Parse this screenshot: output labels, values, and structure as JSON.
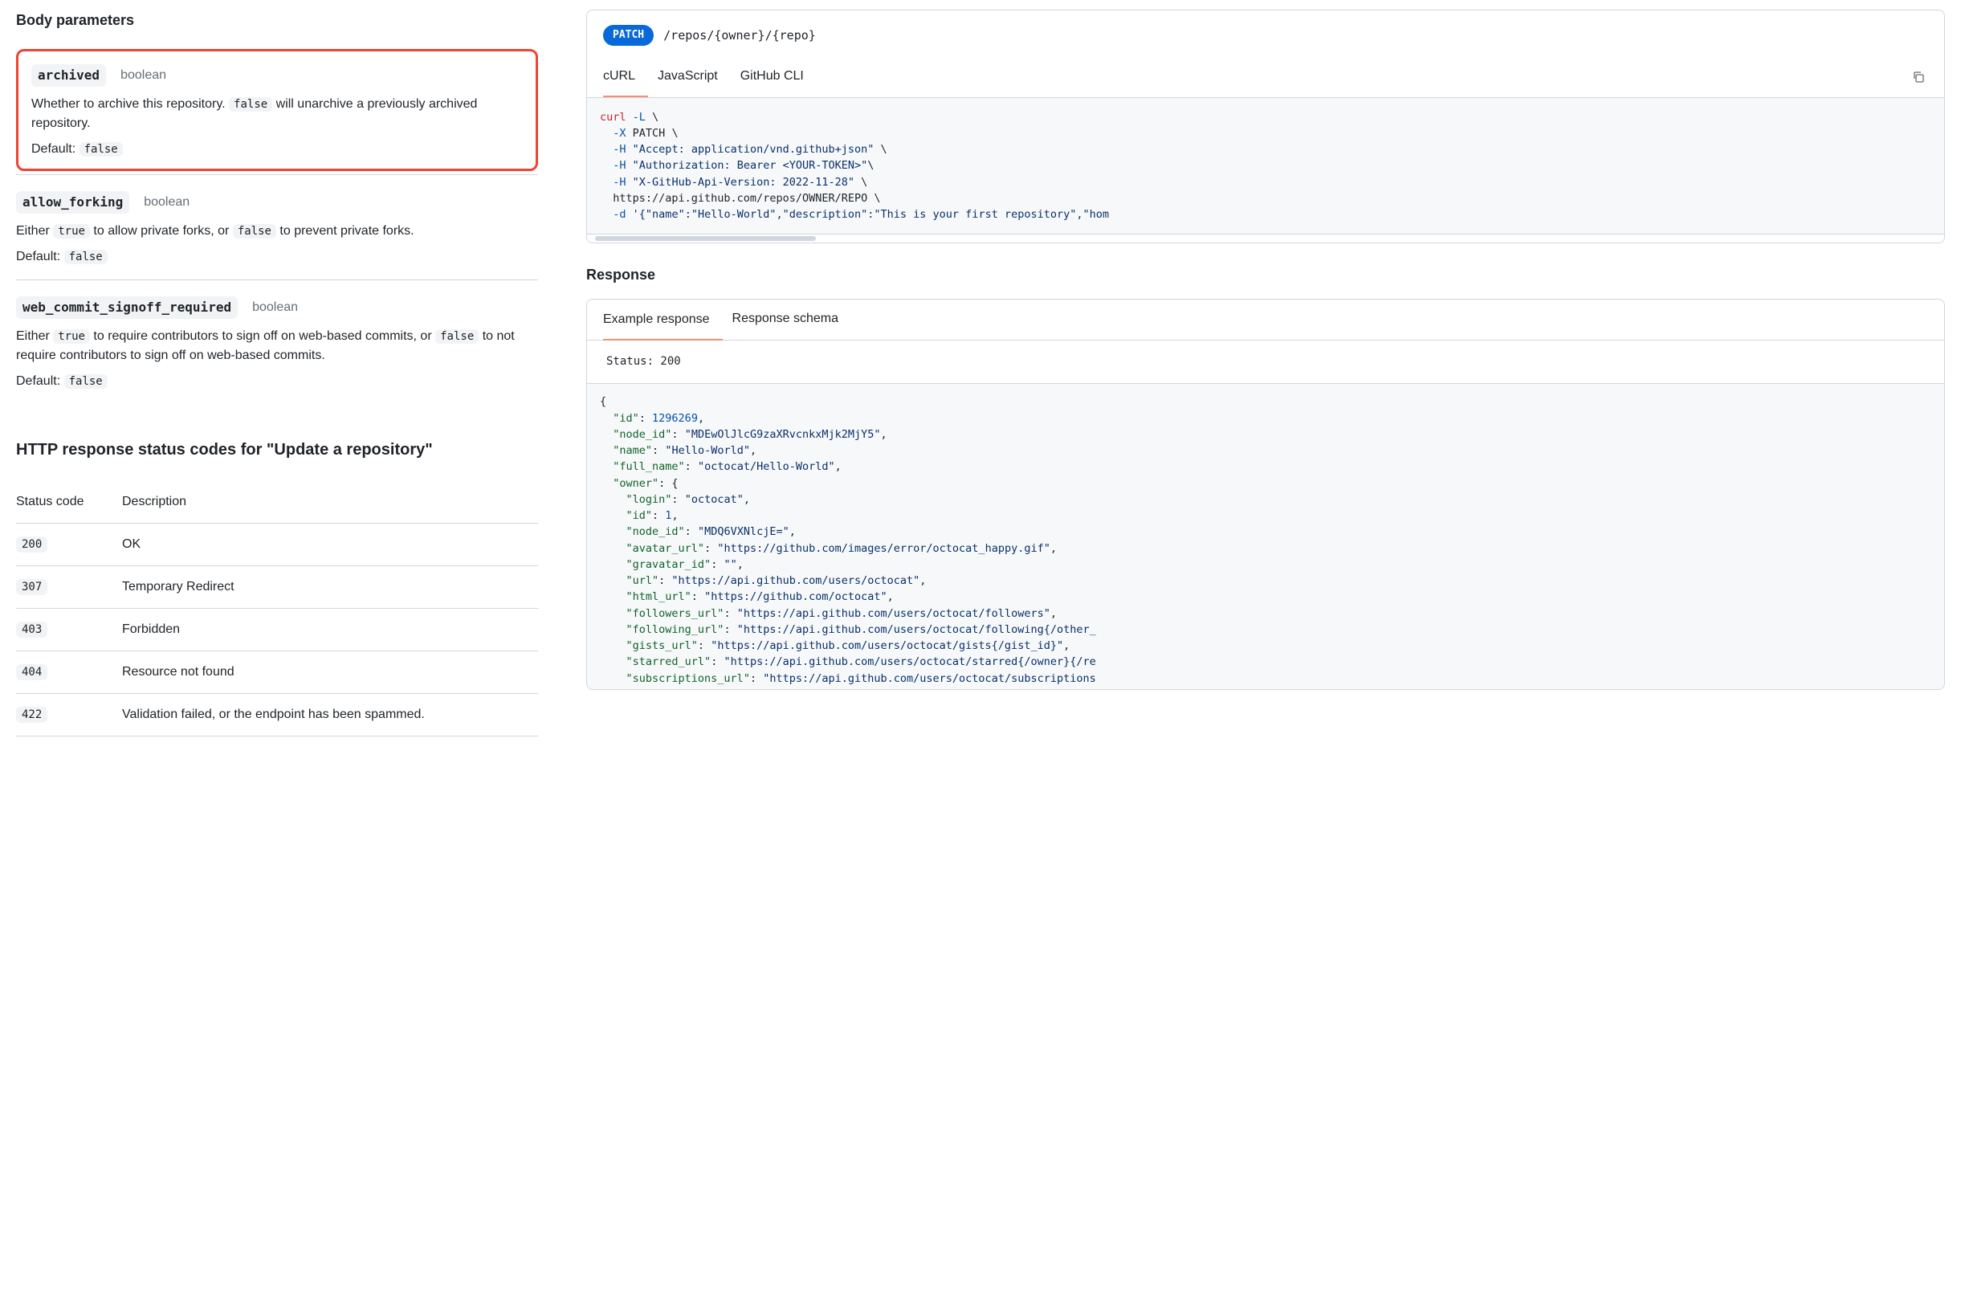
{
  "section_title": "Body parameters",
  "params": [
    {
      "name": "archived",
      "type": "boolean",
      "desc_pre": "Whether to archive this repository. ",
      "desc_code": "false",
      "desc_post": " will unarchive a previously archived repository.",
      "default_label": "Default: ",
      "default_value": "false",
      "highlighted": true
    },
    {
      "name": "allow_forking",
      "type": "boolean",
      "desc_pre": "Either ",
      "desc_code": "true",
      "desc_mid": " to allow private forks, or ",
      "desc_code2": "false",
      "desc_post": " to prevent private forks.",
      "default_label": "Default: ",
      "default_value": "false"
    },
    {
      "name": "web_commit_signoff_required",
      "type": "boolean",
      "desc_pre": "Either ",
      "desc_code": "true",
      "desc_mid": " to require contributors to sign off on web-based commits, or ",
      "desc_code2": "false",
      "desc_post": " to not require contributors to sign off on web-based commits.",
      "default_label": "Default: ",
      "default_value": "false"
    }
  ],
  "status_title": "HTTP response status codes for \"Update a repository\"",
  "status_header": {
    "code": "Status code",
    "desc": "Description"
  },
  "status_rows": [
    {
      "code": "200",
      "desc": "OK"
    },
    {
      "code": "307",
      "desc": "Temporary Redirect"
    },
    {
      "code": "403",
      "desc": "Forbidden"
    },
    {
      "code": "404",
      "desc": "Resource not found"
    },
    {
      "code": "422",
      "desc": "Validation failed, or the endpoint has been spammed."
    }
  ],
  "request": {
    "method": "PATCH",
    "path": "/repos/{owner}/{repo}",
    "tabs": [
      "cURL",
      "JavaScript",
      "GitHub CLI"
    ],
    "active_tab": 0,
    "code_lines": [
      [
        [
          "kw",
          "curl"
        ],
        [
          "plain",
          " "
        ],
        [
          "op",
          "-L"
        ],
        [
          "plain",
          " \\"
        ]
      ],
      [
        [
          "plain",
          "  "
        ],
        [
          "op",
          "-X"
        ],
        [
          "plain",
          " "
        ],
        [
          "plain",
          "PATCH \\"
        ]
      ],
      [
        [
          "plain",
          "  "
        ],
        [
          "op",
          "-H"
        ],
        [
          "plain",
          " "
        ],
        [
          "str",
          "\"Accept: application/vnd.github+json\""
        ],
        [
          "plain",
          " \\"
        ]
      ],
      [
        [
          "plain",
          "  "
        ],
        [
          "op",
          "-H"
        ],
        [
          "plain",
          " "
        ],
        [
          "str",
          "\"Authorization: Bearer <YOUR-TOKEN>\""
        ],
        [
          "plain",
          "\\"
        ]
      ],
      [
        [
          "plain",
          "  "
        ],
        [
          "op",
          "-H"
        ],
        [
          "plain",
          " "
        ],
        [
          "str",
          "\"X-GitHub-Api-Version: 2022-11-28\""
        ],
        [
          "plain",
          " \\"
        ]
      ],
      [
        [
          "plain",
          "  https://api.github.com/repos/OWNER/REPO \\"
        ]
      ],
      [
        [
          "plain",
          "  "
        ],
        [
          "op",
          "-d"
        ],
        [
          "plain",
          " "
        ],
        [
          "str",
          "'{\"name\":\"Hello-World\",\"description\":\"This is your first repository\",\"hom"
        ]
      ]
    ]
  },
  "response": {
    "title": "Response",
    "tabs": [
      "Example response",
      "Response schema"
    ],
    "active_tab": 0,
    "status_label": "Status: 200",
    "json_lines": [
      [
        [
          "jp",
          "{"
        ]
      ],
      [
        [
          "jp",
          "  "
        ],
        [
          "jk",
          "\"id\""
        ],
        [
          "jp",
          ": "
        ],
        [
          "jn",
          "1296269"
        ],
        [
          "jp",
          ","
        ]
      ],
      [
        [
          "jp",
          "  "
        ],
        [
          "jk",
          "\"node_id\""
        ],
        [
          "jp",
          ": "
        ],
        [
          "js",
          "\"MDEwOlJlcG9zaXRvcnkxMjk2MjY5\""
        ],
        [
          "jp",
          ","
        ]
      ],
      [
        [
          "jp",
          "  "
        ],
        [
          "jk",
          "\"name\""
        ],
        [
          "jp",
          ": "
        ],
        [
          "js",
          "\"Hello-World\""
        ],
        [
          "jp",
          ","
        ]
      ],
      [
        [
          "jp",
          "  "
        ],
        [
          "jk",
          "\"full_name\""
        ],
        [
          "jp",
          ": "
        ],
        [
          "js",
          "\"octocat/Hello-World\""
        ],
        [
          "jp",
          ","
        ]
      ],
      [
        [
          "jp",
          "  "
        ],
        [
          "jk",
          "\"owner\""
        ],
        [
          "jp",
          ": {"
        ]
      ],
      [
        [
          "jp",
          "    "
        ],
        [
          "jk",
          "\"login\""
        ],
        [
          "jp",
          ": "
        ],
        [
          "js",
          "\"octocat\""
        ],
        [
          "jp",
          ","
        ]
      ],
      [
        [
          "jp",
          "    "
        ],
        [
          "jk",
          "\"id\""
        ],
        [
          "jp",
          ": "
        ],
        [
          "jn",
          "1"
        ],
        [
          "jp",
          ","
        ]
      ],
      [
        [
          "jp",
          "    "
        ],
        [
          "jk",
          "\"node_id\""
        ],
        [
          "jp",
          ": "
        ],
        [
          "js",
          "\"MDQ6VXNlcjE=\""
        ],
        [
          "jp",
          ","
        ]
      ],
      [
        [
          "jp",
          "    "
        ],
        [
          "jk",
          "\"avatar_url\""
        ],
        [
          "jp",
          ": "
        ],
        [
          "js",
          "\"https://github.com/images/error/octocat_happy.gif\""
        ],
        [
          "jp",
          ","
        ]
      ],
      [
        [
          "jp",
          "    "
        ],
        [
          "jk",
          "\"gravatar_id\""
        ],
        [
          "jp",
          ": "
        ],
        [
          "js",
          "\"\""
        ],
        [
          "jp",
          ","
        ]
      ],
      [
        [
          "jp",
          "    "
        ],
        [
          "jk",
          "\"url\""
        ],
        [
          "jp",
          ": "
        ],
        [
          "js",
          "\"https://api.github.com/users/octocat\""
        ],
        [
          "jp",
          ","
        ]
      ],
      [
        [
          "jp",
          "    "
        ],
        [
          "jk",
          "\"html_url\""
        ],
        [
          "jp",
          ": "
        ],
        [
          "js",
          "\"https://github.com/octocat\""
        ],
        [
          "jp",
          ","
        ]
      ],
      [
        [
          "jp",
          "    "
        ],
        [
          "jk",
          "\"followers_url\""
        ],
        [
          "jp",
          ": "
        ],
        [
          "js",
          "\"https://api.github.com/users/octocat/followers\""
        ],
        [
          "jp",
          ","
        ]
      ],
      [
        [
          "jp",
          "    "
        ],
        [
          "jk",
          "\"following_url\""
        ],
        [
          "jp",
          ": "
        ],
        [
          "js",
          "\"https://api.github.com/users/octocat/following{/other_"
        ]
      ],
      [
        [
          "jp",
          "    "
        ],
        [
          "jk",
          "\"gists_url\""
        ],
        [
          "jp",
          ": "
        ],
        [
          "js",
          "\"https://api.github.com/users/octocat/gists{/gist_id}\""
        ],
        [
          "jp",
          ","
        ]
      ],
      [
        [
          "jp",
          "    "
        ],
        [
          "jk",
          "\"starred_url\""
        ],
        [
          "jp",
          ": "
        ],
        [
          "js",
          "\"https://api.github.com/users/octocat/starred{/owner}{/re"
        ]
      ],
      [
        [
          "jp",
          "    "
        ],
        [
          "jk",
          "\"subscriptions_url\""
        ],
        [
          "jp",
          ": "
        ],
        [
          "js",
          "\"https://api.github.com/users/octocat/subscriptions"
        ]
      ]
    ]
  }
}
